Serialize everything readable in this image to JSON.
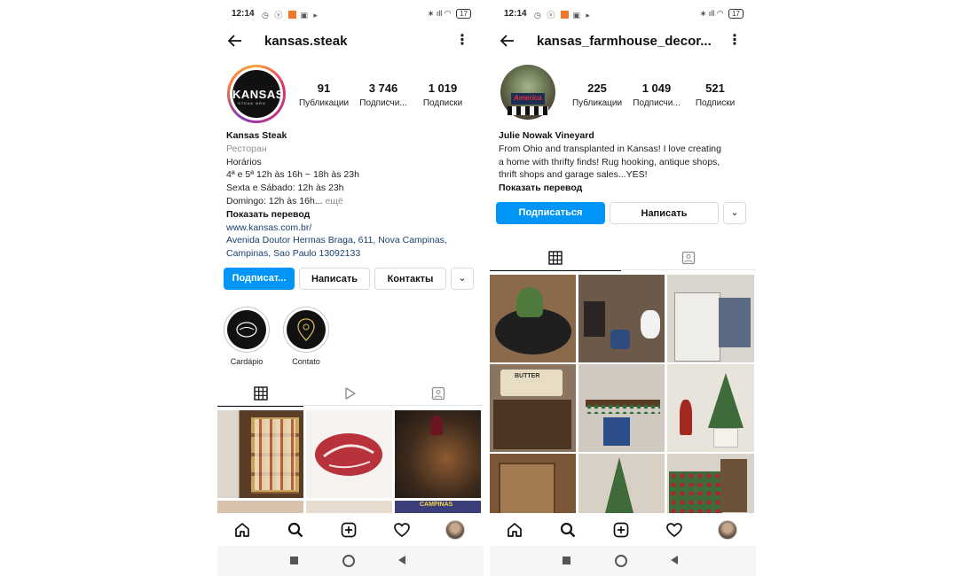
{
  "status": {
    "time": "12:14",
    "battery": "17"
  },
  "left": {
    "username": "kansas.steak",
    "avatar_logo_big": "KANSAS",
    "avatar_logo_small": "STEAK BRG",
    "stats": [
      {
        "num": "91",
        "label": "Публикации"
      },
      {
        "num": "3 746",
        "label": "Подписчи..."
      },
      {
        "num": "1 019",
        "label": "Подписки"
      }
    ],
    "name": "Kansas Steak",
    "category": "Ресторан",
    "bio_lines": [
      "Horários",
      "4ª e 5ª 12h às 16h ~ 18h às 23h",
      "Sexta e Sábado: 12h às 23h"
    ],
    "bio_last": "Domingo: 12h às 16h...",
    "more": " ещё",
    "translate": "Показать перевод",
    "link": "www.kansas.com.br/",
    "address_lines": [
      "Avenida Doutor Hermas Braga, 611, Nova Campinas,",
      "Campinas, Sao Paulo 13092133"
    ],
    "buttons": {
      "follow": "Подписат...",
      "message": "Написать",
      "contacts": "Контакты"
    },
    "highlights": [
      {
        "label": "Cardápio"
      },
      {
        "label": "Contato"
      }
    ]
  },
  "right": {
    "username": "kansas_farmhouse_decor...",
    "avatar_text": "America",
    "stats": [
      {
        "num": "225",
        "label": "Публикации"
      },
      {
        "num": "1 049",
        "label": "Подписчи..."
      },
      {
        "num": "521",
        "label": "Подписки"
      }
    ],
    "name": "Julie Nowak Vineyard",
    "bio_lines": [
      "From Ohio and transplanted in Kansas!  I love creating",
      "a home with thrifty finds!  Rug hooking, antique shops,",
      "thrift shops and garage sales...YES!"
    ],
    "translate": "Показать перевод",
    "buttons": {
      "follow": "Подписаться",
      "message": "Написать"
    },
    "grid_texts": {
      "butter": "BUTTER"
    }
  },
  "grid_left_texts": {
    "campinas": "CAMPINAS"
  },
  "colors": {
    "accent": "#0095f6",
    "link": "#1a3f6e",
    "muted": "#8e8e8e"
  },
  "icons": [
    "back-arrow-icon",
    "more-icon",
    "grid-icon",
    "reels-icon",
    "tagged-icon",
    "home-icon",
    "search-icon",
    "new-post-icon",
    "heart-icon",
    "chevron-down-icon"
  ]
}
